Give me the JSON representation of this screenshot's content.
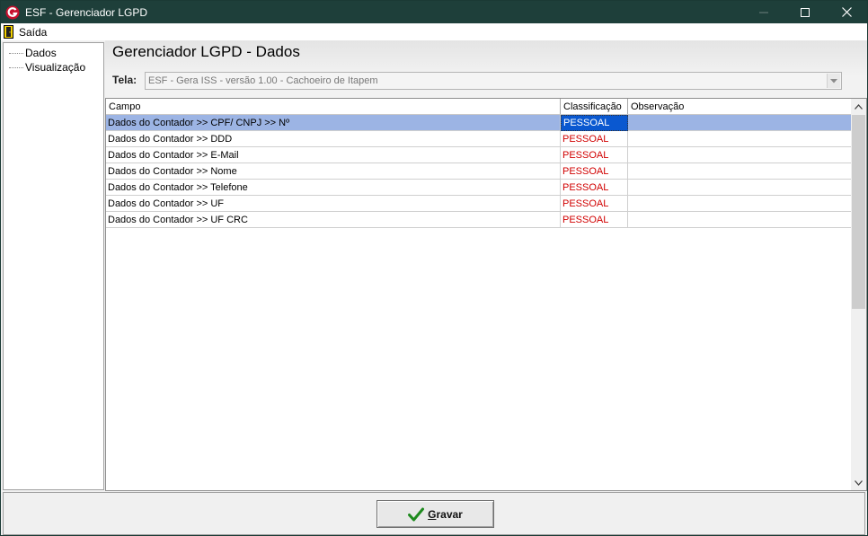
{
  "window": {
    "title": "ESF - Gerenciador LGPD",
    "colors": {
      "titlebar": "#1e3f3a",
      "selection": "#0a58d0",
      "classification_text": "#d10000"
    }
  },
  "menu": {
    "items": [
      {
        "label": "Saída",
        "icon": "exit-door-icon"
      }
    ]
  },
  "sidebar": {
    "items": [
      {
        "label": "Dados"
      },
      {
        "label": "Visualização"
      }
    ]
  },
  "main": {
    "title": "Gerenciador LGPD - Dados",
    "tela_label": "Tela:",
    "tela_value": "ESF - Gera ISS - versão 1.00 - Cachoeiro de Itapem"
  },
  "grid": {
    "columns": [
      "Campo",
      "Classificação",
      "Observação"
    ],
    "rows": [
      {
        "campo": "Dados do Contador >> CPF/ CNPJ >> Nº",
        "classificacao": "PESSOAL",
        "observacao": "",
        "selected": true
      },
      {
        "campo": "Dados do Contador >> DDD",
        "classificacao": "PESSOAL",
        "observacao": ""
      },
      {
        "campo": "Dados do Contador >> E-Mail",
        "classificacao": "PESSOAL",
        "observacao": ""
      },
      {
        "campo": "Dados do Contador >> Nome",
        "classificacao": "PESSOAL",
        "observacao": ""
      },
      {
        "campo": "Dados do Contador >> Telefone",
        "classificacao": "PESSOAL",
        "observacao": ""
      },
      {
        "campo": "Dados do Contador >> UF",
        "classificacao": "PESSOAL",
        "observacao": ""
      },
      {
        "campo": "Dados do Contador >> UF CRC",
        "classificacao": "PESSOAL",
        "observacao": ""
      }
    ]
  },
  "footer": {
    "save_label_first": "G",
    "save_label_rest": "ravar",
    "save_icon": "checkmark-icon"
  }
}
